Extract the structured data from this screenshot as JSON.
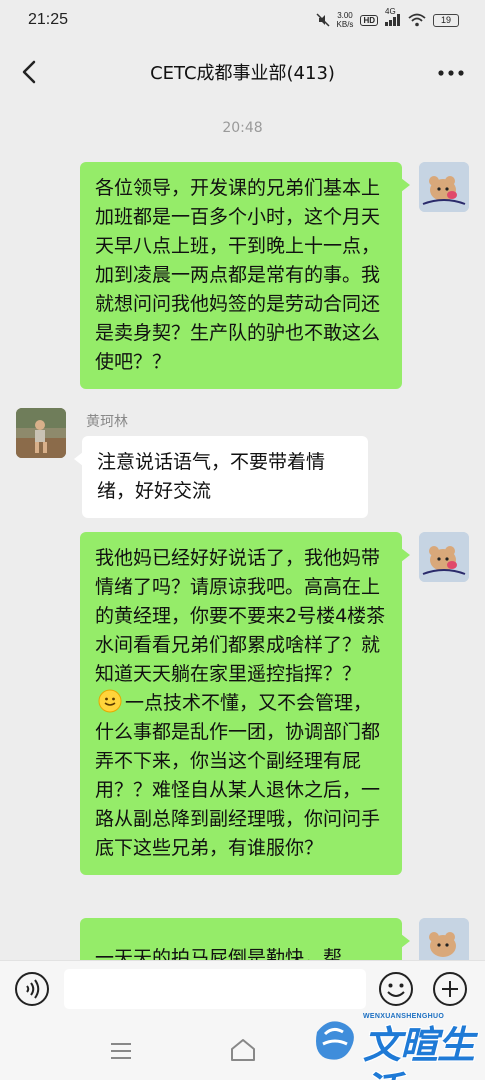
{
  "status_bar": {
    "time": "21:25",
    "speed_value": "3.00",
    "speed_unit": "KB/s",
    "hd": "HD",
    "network": "4G",
    "battery": "19"
  },
  "header": {
    "title": "CETC成都事业部(413)"
  },
  "chat": {
    "timestamp": "20:48",
    "messages": [
      {
        "sender": "self",
        "text": "各位领导，开发课的兄弟们基本上加班都是一百多个小时，这个月天天早八点上班，干到晚上十一点，加到凌晨一两点都是常有的事。我就想问问我他妈签的是劳动合同还是卖身契？生产队的驴也不敢这么使吧？？"
      },
      {
        "sender": "other",
        "name": "黄珂林",
        "text": "注意说话语气，不要带着情绪，好好交流"
      },
      {
        "sender": "self",
        "text_part1": "我他妈已经好好说话了，我他妈带情绪了吗？请原谅我吧。高高在上的黄经理，你要不要来2号楼4楼茶水间看看兄弟们都累成啥样了？就知道天天躺在家里遥控指挥？？",
        "emoji": "smile-emoji",
        "text_part2": "一点技术不懂，又不会管理，什么事都是乱作一团，协调部门都弄不下来，你当这个副经理有屁用？？难怪自从某人退休之后，一路从副总降到副经理哦，你问问手底下这些兄弟，有谁服你？"
      },
      {
        "sender": "self",
        "text": "一天天的拍马屁倒是勤快，帮"
      }
    ]
  },
  "input_bar": {
    "value": "",
    "placeholder": ""
  },
  "watermark": {
    "small_text": "WENXUANSHENGHUO",
    "big_text": "文暄生活"
  },
  "colors": {
    "background": "#ededed",
    "self_bubble": "#95ec69",
    "other_bubble": "#ffffff",
    "watermark": "#1f7ad6"
  },
  "icons": [
    "back-arrow-icon",
    "more-dots-icon",
    "voice-icon",
    "emoji-icon",
    "plus-icon",
    "nav-menu-icon",
    "nav-home-icon"
  ]
}
